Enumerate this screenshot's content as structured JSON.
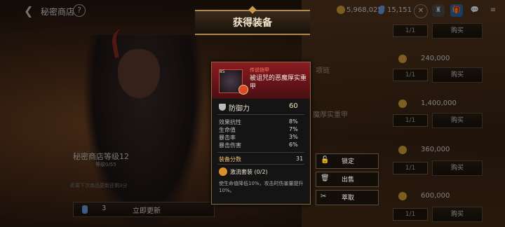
{
  "header": {
    "shop_title": "秘密商店",
    "help": "?",
    "gold": "5,968,025",
    "gems": "15,151"
  },
  "dialog": {
    "title": "获得装备"
  },
  "item": {
    "level": "85",
    "rarity": "传说铠甲",
    "name": "被诅咒的恶魔厚实重甲",
    "main_stat": {
      "label": "防御力",
      "value": "60"
    },
    "sub_stats": [
      {
        "label": "效果抗性",
        "value": "8%"
      },
      {
        "label": "生命值",
        "value": "7%"
      },
      {
        "label": "暴击率",
        "value": "3%"
      },
      {
        "label": "暴击伤害",
        "value": "6%"
      }
    ],
    "score_label": "装备分数",
    "score_value": "31",
    "set_name": "激流套装 (0/2)",
    "set_desc": "使生命值降低10%，攻击时伤害量提升10%。"
  },
  "actions": [
    {
      "label": "锁定",
      "icon": "lock-icon"
    },
    {
      "label": "出售",
      "icon": "trash-icon"
    },
    {
      "label": "萃取",
      "icon": "extract-icon"
    }
  ],
  "shop_rows": [
    {
      "qty": "1/1",
      "buy": "购买",
      "price": ""
    },
    {
      "qty": "1/1",
      "buy": "购买",
      "price": "240,000"
    },
    {
      "qty": "1/1",
      "buy": "购买",
      "price": "1,400,000"
    },
    {
      "qty": "1/1",
      "buy": "购买",
      "price": "360,000"
    },
    {
      "qty": "1/1",
      "buy": "购买",
      "price": "600,000"
    }
  ],
  "bg_texts": {
    "item2": "项链",
    "item3": "魔厚实重甲"
  },
  "shop_level": {
    "label": "秘密商店等级12",
    "sub": "等级0/55"
  },
  "notice": "距离下次商品更新还剩3分",
  "refresh": {
    "cost": "3",
    "label": "立即更新"
  }
}
